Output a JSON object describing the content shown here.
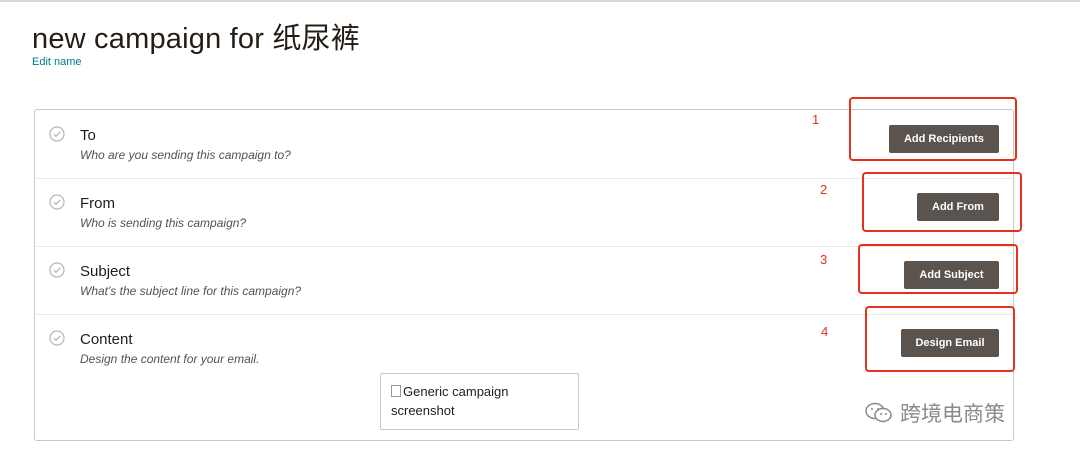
{
  "page": {
    "title": "new campaign for 纸尿裤",
    "edit_name": "Edit name"
  },
  "checklist": [
    {
      "title": "To",
      "description": "Who are you sending this campaign to?",
      "action": "Add Recipients",
      "marker": "1"
    },
    {
      "title": "From",
      "description": "Who is sending this campaign?",
      "action": "Add From",
      "marker": "2"
    },
    {
      "title": "Subject",
      "description": "What's the subject line for this campaign?",
      "action": "Add Subject",
      "marker": "3"
    },
    {
      "title": "Content",
      "description": "Design the content for your email.",
      "action": "Design Email",
      "marker": "4"
    }
  ],
  "content_preview": {
    "alt_text": "Generic campaign screenshot"
  },
  "watermark": {
    "text": "跨境电商策"
  },
  "colors": {
    "button_bg": "#5b534d",
    "annotation_red": "#e2311d",
    "link": "#007c89"
  }
}
